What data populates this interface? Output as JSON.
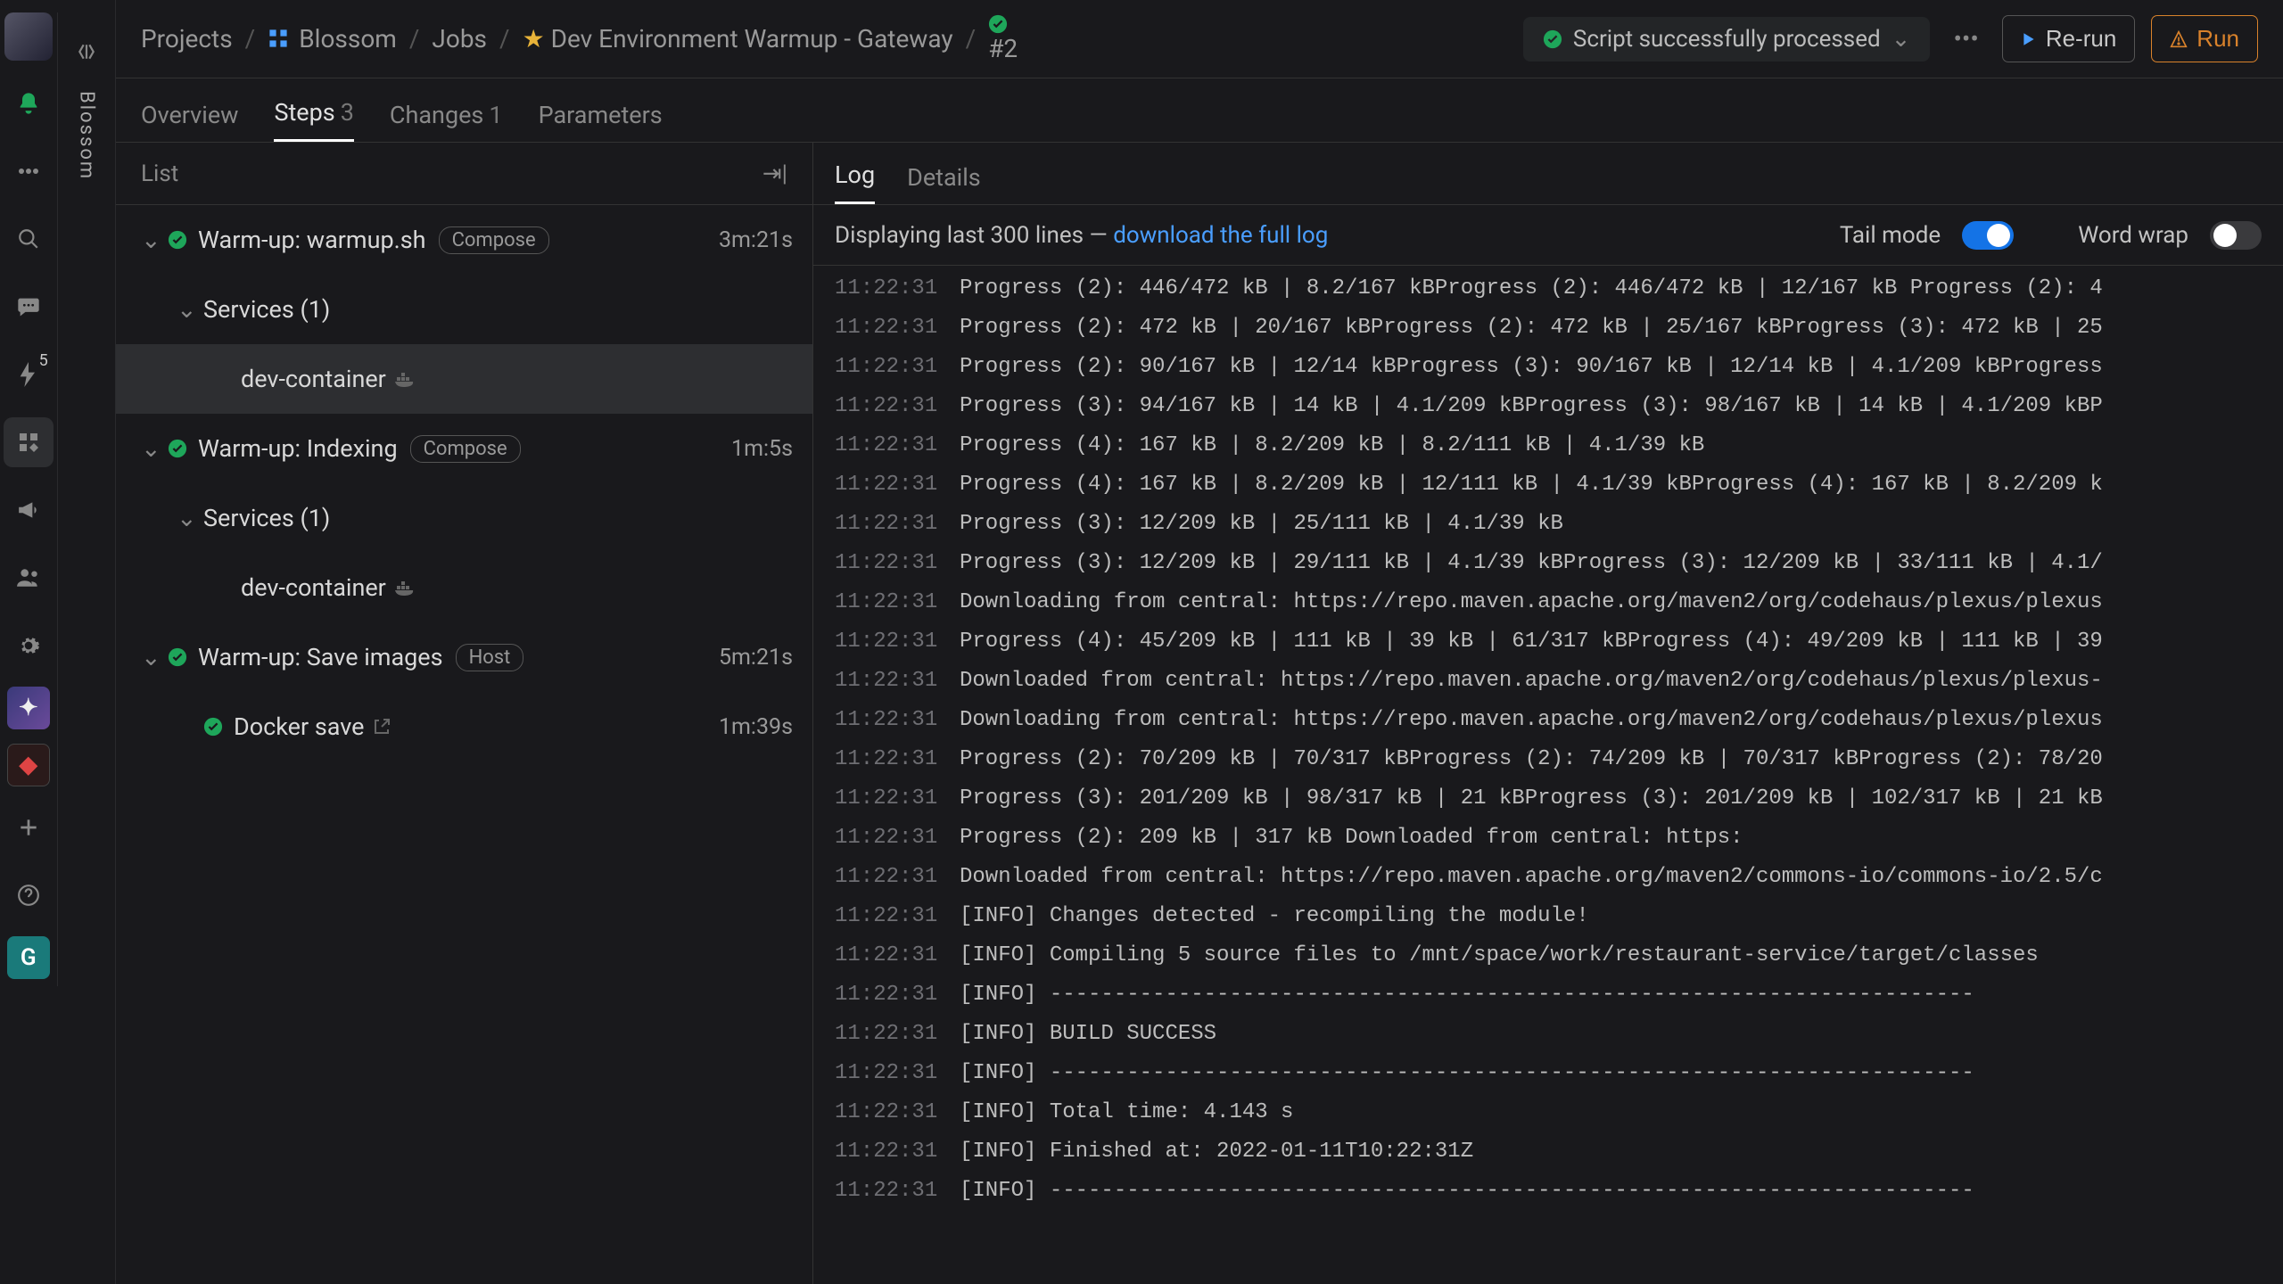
{
  "breadcrumb": {
    "projects": "Projects",
    "workspace": "Blossom",
    "jobs": "Jobs",
    "job": "Dev Environment Warmup - Gateway",
    "run": "#2"
  },
  "topbar": {
    "status": "Script successfully processed",
    "rerun": "Re-run",
    "run": "Run"
  },
  "subtabs": {
    "overview": "Overview",
    "steps": "Steps",
    "steps_count": "3",
    "changes": "Changes",
    "changes_count": "1",
    "parameters": "Parameters"
  },
  "rail": {
    "text": "Blossom",
    "badge5": "5",
    "bottom_letter": "G"
  },
  "steps_panel": {
    "header": "List",
    "rows": [
      {
        "label": "Warm-up: warmup.sh",
        "chip": "Compose",
        "dur": "3m:21s",
        "lvl": 1,
        "caret": true,
        "ok": true
      },
      {
        "label": "Services (1)",
        "lvl": 2,
        "caret": true
      },
      {
        "label": "dev-container",
        "lvl": 3,
        "docker": true,
        "selected": true
      },
      {
        "label": "Warm-up: Indexing",
        "chip": "Compose",
        "dur": "1m:5s",
        "lvl": 1,
        "caret": true,
        "ok": true
      },
      {
        "label": "Services (1)",
        "lvl": 2,
        "caret": true
      },
      {
        "label": "dev-container",
        "lvl": 3,
        "docker": true
      },
      {
        "label": "Warm-up: Save images",
        "chip": "Host",
        "dur": "5m:21s",
        "lvl": 1,
        "caret": true,
        "ok": true
      },
      {
        "label": "Docker save",
        "dur": "1m:39s",
        "lvl": 2,
        "ok": true,
        "ext": true
      }
    ]
  },
  "log_panel": {
    "tab_log": "Log",
    "tab_details": "Details",
    "displaying": "Displaying last 300 lines — ",
    "download": "download the full log",
    "tail_label": "Tail mode",
    "wrap_label": "Word wrap",
    "lines": [
      {
        "t": "11:22:31",
        "m": "Progress (2): 446/472 kB | 8.2/167 kBProgress (2): 446/472 kB | 12/167 kB Progress (2): 4"
      },
      {
        "t": "11:22:31",
        "m": "Progress (2): 472 kB | 20/167 kBProgress (2): 472 kB | 25/167 kBProgress (3): 472 kB | 25"
      },
      {
        "t": "11:22:31",
        "m": "Progress (2): 90/167 kB | 12/14 kBProgress (3): 90/167 kB | 12/14 kB | 4.1/209 kBProgress"
      },
      {
        "t": "11:22:31",
        "m": "Progress (3): 94/167 kB | 14 kB | 4.1/209 kBProgress (3): 98/167 kB | 14 kB | 4.1/209 kBP"
      },
      {
        "t": "11:22:31",
        "m": "Progress (4): 167 kB | 8.2/209 kB | 8.2/111 kB | 4.1/39 kB"
      },
      {
        "t": "11:22:31",
        "m": "Progress (4): 167 kB | 8.2/209 kB | 12/111 kB | 4.1/39 kBProgress (4): 167 kB | 8.2/209 k"
      },
      {
        "t": "11:22:31",
        "m": "Progress (3): 12/209 kB | 25/111 kB | 4.1/39 kB"
      },
      {
        "t": "11:22:31",
        "m": "Progress (3): 12/209 kB | 29/111 kB | 4.1/39 kBProgress (3): 12/209 kB | 33/111 kB | 4.1/"
      },
      {
        "t": "11:22:31",
        "m": "Downloading from central: https://repo.maven.apache.org/maven2/org/codehaus/plexus/plexus"
      },
      {
        "t": "11:22:31",
        "m": "Progress (4): 45/209 kB | 111 kB | 39 kB | 61/317 kBProgress (4): 49/209 kB | 111 kB | 39"
      },
      {
        "t": "11:22:31",
        "m": "Downloaded from central: https://repo.maven.apache.org/maven2/org/codehaus/plexus/plexus-"
      },
      {
        "t": "11:22:31",
        "m": "Downloading from central: https://repo.maven.apache.org/maven2/org/codehaus/plexus/plexus"
      },
      {
        "t": "11:22:31",
        "m": "Progress (2): 70/209 kB | 70/317 kBProgress (2): 74/209 kB | 70/317 kBProgress (2): 78/20"
      },
      {
        "t": "11:22:31",
        "m": "Progress (3): 201/209 kB | 98/317 kB | 21 kBProgress (3): 201/209 kB | 102/317 kB | 21 kB"
      },
      {
        "t": "11:22:31",
        "m": "Progress (2): 209 kB | 317 kB                                        Downloaded from central: https:"
      },
      {
        "t": "11:22:31",
        "m": "Downloaded from central: https://repo.maven.apache.org/maven2/commons-io/commons-io/2.5/c"
      },
      {
        "t": "11:22:31",
        "m": "[INFO] Changes detected - recompiling the module!"
      },
      {
        "t": "11:22:31",
        "m": "[INFO] Compiling 5 source files to /mnt/space/work/restaurant-service/target/classes"
      },
      {
        "t": "11:22:31",
        "m": "[INFO] ------------------------------------------------------------------------"
      },
      {
        "t": "11:22:31",
        "m": "[INFO] BUILD SUCCESS"
      },
      {
        "t": "11:22:31",
        "m": "[INFO] ------------------------------------------------------------------------"
      },
      {
        "t": "11:22:31",
        "m": "[INFO] Total time:  4.143 s"
      },
      {
        "t": "11:22:31",
        "m": "[INFO] Finished at: 2022-01-11T10:22:31Z"
      },
      {
        "t": "11:22:31",
        "m": "[INFO] ------------------------------------------------------------------------"
      }
    ]
  }
}
